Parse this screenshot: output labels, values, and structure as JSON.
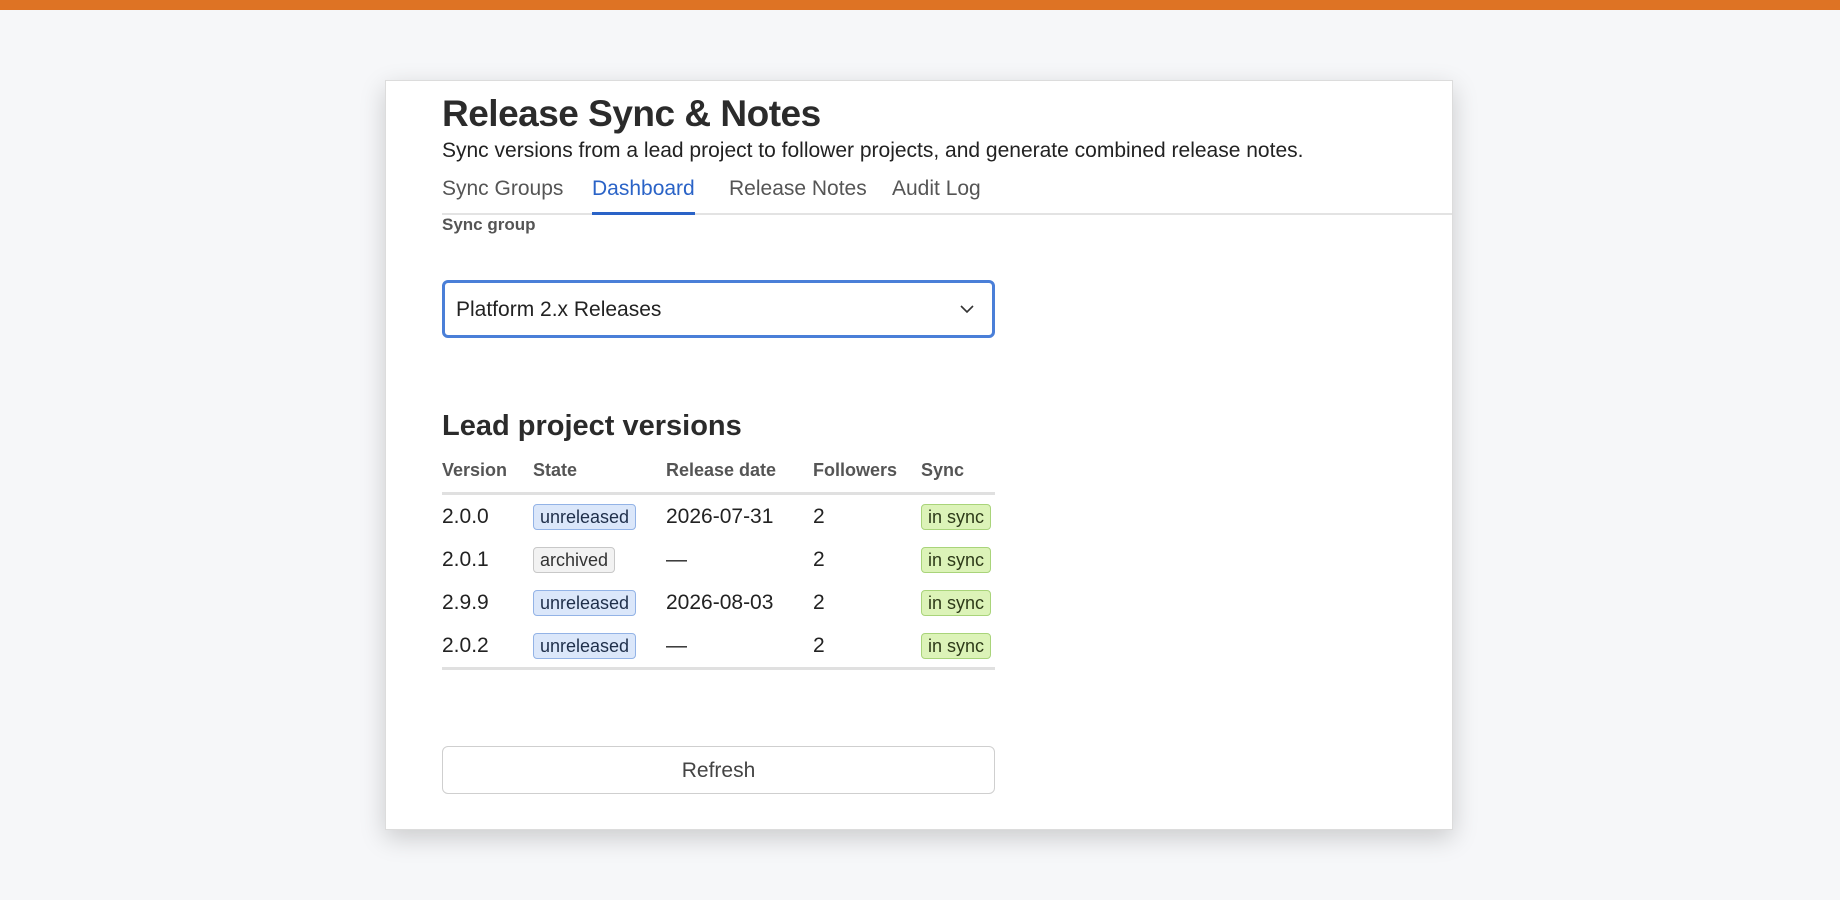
{
  "app": {
    "title": "Release Sync & Notes",
    "subtitle": "Sync versions from a lead project to follower projects, and generate combined release notes.",
    "accent_color": "#de7324"
  },
  "tabs": [
    {
      "label": "Sync Groups",
      "active": false
    },
    {
      "label": "Dashboard",
      "active": true
    },
    {
      "label": "Release Notes",
      "active": false
    },
    {
      "label": "Audit Log",
      "active": false
    }
  ],
  "sync_group": {
    "label": "Sync group",
    "selected": "Platform 2.x Releases",
    "icon": "chevron-down-icon"
  },
  "versions_section": {
    "title": "Lead project versions",
    "columns": [
      "Version",
      "State",
      "Release date",
      "Followers",
      "Sync"
    ],
    "rows": [
      {
        "version": "2.0.0",
        "state": "unreleased",
        "release_date": "2026-07-31",
        "followers": "2",
        "sync": "in sync"
      },
      {
        "version": "2.0.1",
        "state": "archived",
        "release_date": "—",
        "followers": "2",
        "sync": "in sync"
      },
      {
        "version": "2.9.9",
        "state": "unreleased",
        "release_date": "2026-08-03",
        "followers": "2",
        "sync": "in sync"
      },
      {
        "version": "2.0.2",
        "state": "unreleased",
        "release_date": "—",
        "followers": "2",
        "sync": "in sync"
      }
    ]
  },
  "actions": {
    "refresh_label": "Refresh"
  }
}
